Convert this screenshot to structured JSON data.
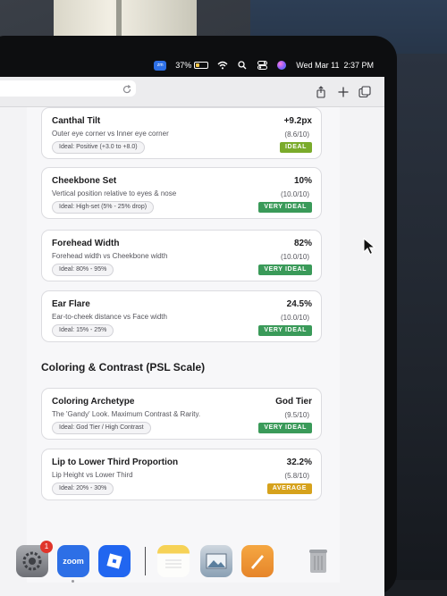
{
  "menubar": {
    "zoom_label": "zm",
    "battery_percent": "37%",
    "battery_level": 0.37,
    "datetime": "Wed Mar 11  2:37 PM",
    "icons": [
      "zoom-icon",
      "battery-icon",
      "wifi-icon",
      "search-icon",
      "control-center-icon",
      "siri-icon"
    ]
  },
  "browser": {
    "icons": [
      "reload-icon",
      "share-icon",
      "new-tab-icon",
      "tab-overview-icon"
    ]
  },
  "cards": [
    {
      "title": "Canthal Tilt",
      "description": "Outer eye corner vs Inner eye corner",
      "ideal": "Ideal: Positive (+3.0 to +8.0)",
      "metric": "+9.2px",
      "score": "(8.6/10)",
      "verdict": "IDEAL",
      "verdict_color": "#7aab2b"
    },
    {
      "title": "Cheekbone Set",
      "description": "Vertical position relative to eyes & nose",
      "ideal": "Ideal: High-set (5% - 25% drop)",
      "metric": "10%",
      "score": "(10.0/10)",
      "verdict": "VERY IDEAL",
      "verdict_color": "#3a9a59"
    },
    {
      "title": "Forehead Width",
      "description": "Forehead width vs Cheekbone width",
      "ideal": "Ideal: 80% - 95%",
      "metric": "82%",
      "score": "(10.0/10)",
      "verdict": "VERY IDEAL",
      "verdict_color": "#3a9a59"
    },
    {
      "title": "Ear Flare",
      "description": "Ear-to-cheek distance vs Face width",
      "ideal": "Ideal: 15% - 25%",
      "metric": "24.5%",
      "score": "(10.0/10)",
      "verdict": "VERY IDEAL",
      "verdict_color": "#3a9a59"
    },
    {
      "title": "Coloring Archetype",
      "description": "The 'Gandy' Look. Maximum Contrast & Rarity.",
      "ideal": "Ideal: God Tier / High Contrast",
      "metric": "God Tier",
      "score": "(9.5/10)",
      "verdict": "VERY IDEAL",
      "verdict_color": "#3a9a59"
    },
    {
      "title": "Lip to Lower Third Proportion",
      "description": "Lip Height vs Lower Third",
      "ideal": "Ideal: 20% - 30%",
      "metric": "32.2%",
      "score": "(5.8/10)",
      "verdict": "AVERAGE",
      "verdict_color": "#d6a21c"
    }
  ],
  "section": {
    "heading": "Coloring & Contrast (PSL Scale)"
  },
  "dock": {
    "settings_badge": "1",
    "zoom_label": "zoom",
    "apps": [
      "system-settings-icon",
      "zoom-app-icon",
      "roblox-icon",
      "notes-icon",
      "preview-icon",
      "pages-icon",
      "trash-icon"
    ]
  }
}
